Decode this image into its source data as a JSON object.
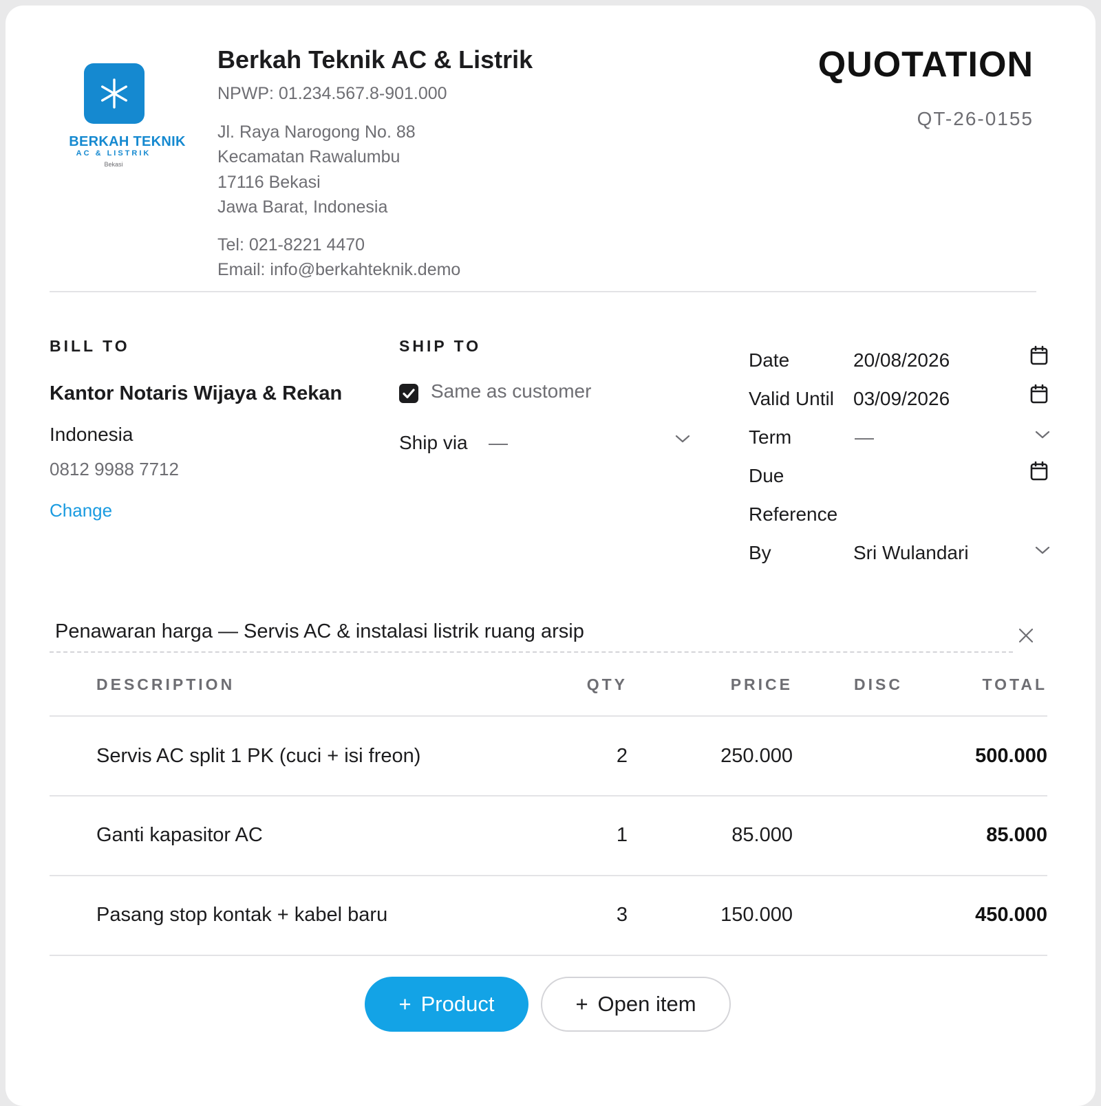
{
  "company": {
    "logo": {
      "line1": "BERKAH TEKNIK",
      "line2": "AC & LISTRIK",
      "line3": "Bekasi",
      "icon": "snowflake-asterisk-icon",
      "color": "#1589d0"
    },
    "name": "Berkah Teknik AC & Listrik",
    "npwp": "NPWP: 01.234.567.8-901.000",
    "address": [
      "Jl. Raya Narogong No. 88",
      "Kecamatan Rawalumbu",
      "17116 Bekasi",
      "Jawa Barat, Indonesia"
    ],
    "tel": "Tel: 021-8221 4470",
    "email": "Email: info@berkahteknik.demo"
  },
  "document": {
    "title": "QUOTATION",
    "number": "QT-26-0155"
  },
  "bill_to": {
    "heading": "BILL TO",
    "name": "Kantor Notaris Wijaya & Rekan",
    "country": "Indonesia",
    "phone": "0812 9988 7712",
    "change_label": "Change"
  },
  "ship_to": {
    "heading": "SHIP TO",
    "same_as_customer_label": "Same as customer",
    "same_as_customer_checked": true,
    "ship_via_label": "Ship via",
    "ship_via_value": "—"
  },
  "meta": {
    "date_label": "Date",
    "date_value": "20/08/2026",
    "valid_until_label": "Valid Until",
    "valid_until_value": "03/09/2026",
    "term_label": "Term",
    "term_value": "—",
    "due_label": "Due",
    "due_value": "",
    "reference_label": "Reference",
    "reference_value": "",
    "by_label": "By",
    "by_value": "Sri Wulandari"
  },
  "subject": "Penawaran harga — Servis AC & instalasi listrik ruang arsip",
  "table": {
    "headers": {
      "description": "DESCRIPTION",
      "qty": "QTY",
      "price": "PRICE",
      "disc": "DISC",
      "total": "TOTAL"
    },
    "rows": [
      {
        "description": "Servis AC split 1 PK (cuci + isi freon)",
        "qty": "2",
        "price": "250.000",
        "disc": "",
        "total": "500.000"
      },
      {
        "description": "Ganti kapasitor AC",
        "qty": "1",
        "price": "85.000",
        "disc": "",
        "total": "85.000"
      },
      {
        "description": "Pasang stop kontak + kabel baru",
        "qty": "3",
        "price": "150.000",
        "disc": "",
        "total": "450.000"
      }
    ]
  },
  "actions": {
    "add_product": "Product",
    "add_open_item": "Open item",
    "plus": "+"
  },
  "colors": {
    "accent": "#13a3e6",
    "link": "#1a9be0",
    "brand": "#1589d0"
  }
}
